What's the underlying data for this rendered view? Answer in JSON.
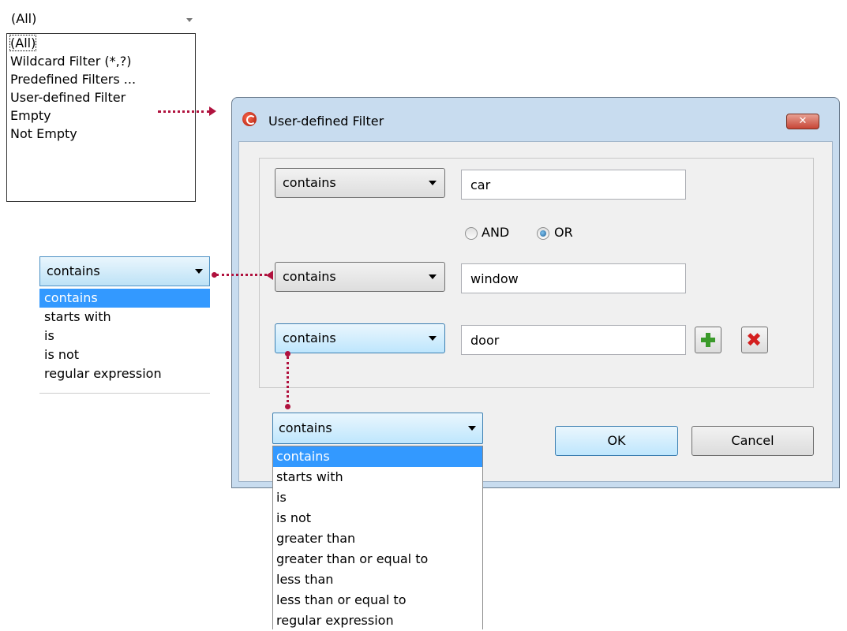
{
  "top_filter": {
    "selected": "(All)",
    "items": [
      "(All)",
      "Wildcard Filter (*,?)",
      "Predefined Filters ...",
      "User-defined Filter",
      "Empty",
      "Not Empty"
    ]
  },
  "left_operator": {
    "selected": "contains",
    "items": [
      "contains",
      "starts with",
      "is",
      "is not",
      "regular expression"
    ]
  },
  "dialog": {
    "title": "User-defined Filter",
    "close_label": "✕",
    "rows": [
      {
        "operator": "contains",
        "value": "car"
      },
      {
        "operator": "contains",
        "value": "window"
      },
      {
        "operator": "contains",
        "value": "door"
      }
    ],
    "logic": {
      "and_label": "AND",
      "or_label": "OR",
      "selected": "OR"
    },
    "ok_label": "OK",
    "cancel_label": "Cancel"
  },
  "bottom_operator": {
    "selected": "contains",
    "items": [
      "contains",
      "starts with",
      "is",
      "is not",
      "greater than",
      "greater than or equal to",
      "less than",
      "less than or equal to",
      "regular expression"
    ]
  },
  "colors": {
    "connector": "#b0123e",
    "selection": "#3399ff"
  }
}
